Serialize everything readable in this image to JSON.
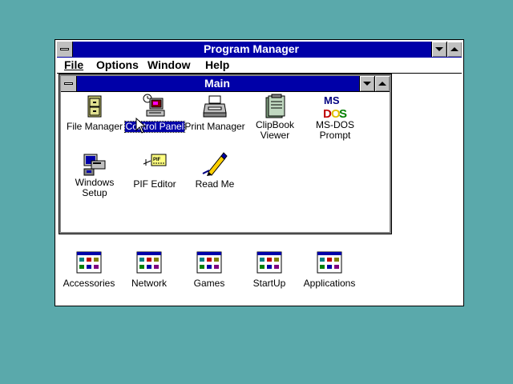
{
  "program_manager": {
    "title": "Program Manager",
    "menu": [
      "File",
      "Options",
      "Window",
      "Help"
    ]
  },
  "main_group": {
    "title": "Main",
    "icons": [
      {
        "label": "File Manager"
      },
      {
        "label": "Control Panel",
        "selected": true
      },
      {
        "label": "Print Manager"
      },
      {
        "label": "ClipBook\nViewer"
      },
      {
        "label": "MS-DOS\nPrompt"
      },
      {
        "label": "Windows\nSetup"
      },
      {
        "label": "PIF Editor"
      },
      {
        "label": "Read Me"
      }
    ]
  },
  "groups": [
    {
      "label": "Accessories"
    },
    {
      "label": "Network"
    },
    {
      "label": "Games"
    },
    {
      "label": "StartUp"
    },
    {
      "label": "Applications"
    }
  ],
  "colors": {
    "desktop": "#5aa9ab",
    "title_active": "#0000a8"
  }
}
